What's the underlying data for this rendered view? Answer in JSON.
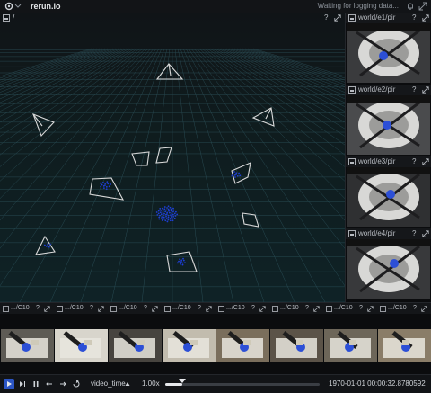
{
  "app": {
    "title": "rerun.io",
    "status": "Waiting for logging data..."
  },
  "main_view": {
    "path": "/"
  },
  "side_views": [
    {
      "label": "world/e1/pir"
    },
    {
      "label": "world/e2/pir"
    },
    {
      "label": "world/e3/pir"
    },
    {
      "label": "world/e4/pir"
    }
  ],
  "strip_tabs": [
    {
      "label": ".../C10"
    },
    {
      "label": ".../C10"
    },
    {
      "label": ".../C10"
    },
    {
      "label": ".../C10"
    },
    {
      "label": ".../C10"
    },
    {
      "label": ".../C10"
    },
    {
      "label": ".../C10"
    },
    {
      "label": ".../C10"
    }
  ],
  "controls": {
    "timeline": "video_time",
    "speed": "1.00x",
    "time": "1970-01-01 00:00:32.8780592",
    "progress": 0.11
  },
  "colors": {
    "accent": "#3b7ee8",
    "grid": "#3c6e7a",
    "camera": "#d9d9d9",
    "points": "#1e3fd6"
  }
}
